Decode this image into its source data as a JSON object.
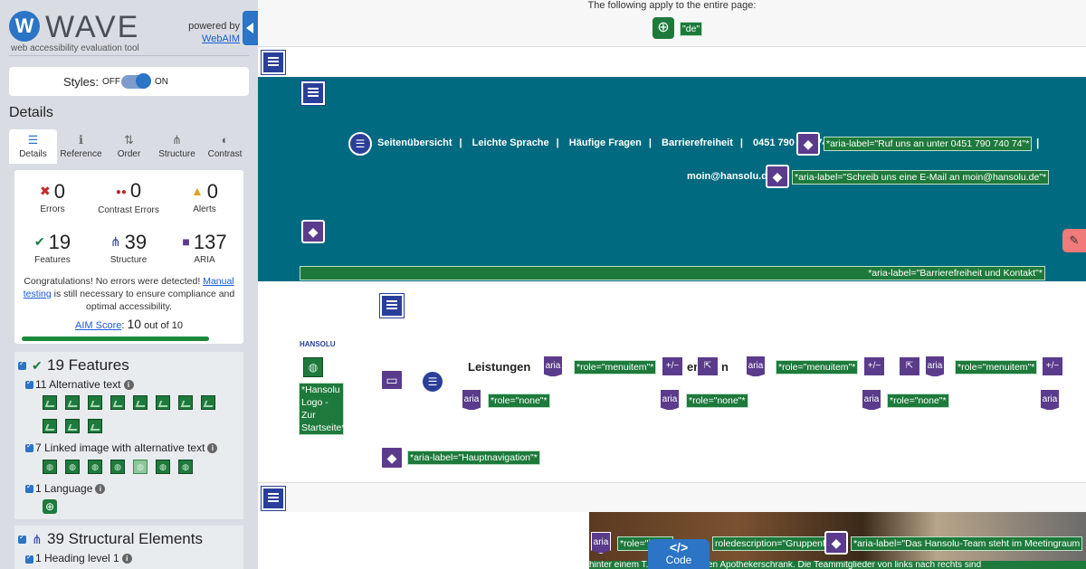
{
  "sidebar": {
    "brand": "WAVE",
    "brand_mark": "W",
    "brand_sub": "web accessibility evaluation tool",
    "powered_by": "powered by",
    "powered_link": "WebAIM",
    "styles_label": "Styles:",
    "styles_off": "OFF",
    "styles_on": "ON",
    "details_title": "Details",
    "tabs": [
      {
        "label": "Details",
        "icon": "list-icon",
        "glyph": "☰"
      },
      {
        "label": "Reference",
        "icon": "info-icon",
        "glyph": "ℹ"
      },
      {
        "label": "Order",
        "icon": "order-icon",
        "glyph": "⇅"
      },
      {
        "label": "Structure",
        "icon": "structure-icon",
        "glyph": "⋔"
      },
      {
        "label": "Contrast",
        "icon": "contrast-icon",
        "glyph": "◐"
      }
    ],
    "stats": [
      {
        "value": "0",
        "label": "Errors",
        "icon": "error-icon",
        "glyph": "✖",
        "color": "#c62828"
      },
      {
        "value": "0",
        "label": "Contrast Errors",
        "icon": "contrast-error-icon",
        "glyph": "●●",
        "color": "#c62828"
      },
      {
        "value": "0",
        "label": "Alerts",
        "icon": "alert-icon",
        "glyph": "▲",
        "color": "#e0a020"
      },
      {
        "value": "19",
        "label": "Features",
        "icon": "feature-icon",
        "glyph": "✔",
        "color": "#1e7a3c"
      },
      {
        "value": "39",
        "label": "Structure",
        "icon": "structure-icon",
        "glyph": "⋔",
        "color": "#2a3f9a"
      },
      {
        "value": "137",
        "label": "ARIA",
        "icon": "aria-icon",
        "glyph": "■",
        "color": "#5b3b8c"
      }
    ],
    "congrats_text": "Congratulations! No errors were detected!",
    "manual_link": "Manual testing",
    "congrats_rest": "is still necessary to ensure compliance and optimal accessibility.",
    "aim_label": "AIM Score",
    "aim_value": "10",
    "aim_suffix": "out of 10",
    "features_heading": "19 Features",
    "alt_text_row": "11 Alternative text",
    "linked_image_row": "7 Linked image with alternative text",
    "language_row": "1 Language",
    "structural_heading": "39 Structural Elements",
    "heading_row": "1 Heading level 1"
  },
  "page": {
    "top_note": "The following apply to the entire page:",
    "lang_tag": "\"de\"",
    "nav_links": [
      "Seitenübersicht",
      "Leichte Sprache",
      "Häufige Fragen",
      "Barrierefreiheit",
      "0451 790 740 74"
    ],
    "aria_phone": "*aria-label=\"Ruf uns an unter 0451 790 740 74\"*",
    "email": "moin@hansolu.de",
    "aria_email": "*aria-label=\"Schreib uns eine E-Mail an moin@hansolu.de\"*",
    "aria_contact": "*aria-label=\"Barrierefreiheit und Kontakt\"*",
    "logo_text": "HANSOLU",
    "logo_alt": "*Hansolu Logo - Zur Startseite*",
    "menu_label": "Leistungen",
    "role_menuitem": "*role=\"menuitem\"*",
    "role_none": "*role=\"none\"*",
    "aria_hauptnav": "*aria-label=\"Hauptnavigation\"*",
    "role_img": "*role=\"img\"*",
    "roledesc": "roledescription=\"Gruppenfoto\"*",
    "aria_team": "*aria-label=\"Das Hansolu-Team steht im Meetingraum",
    "photo_caption": "hinter einem T... vor einem alten Apothekerschrank. Die Teammitglieder von links nach rechts sind",
    "code_label": "Code",
    "code_glyph": "</>",
    "aria_text": "aria",
    "pm_text": "+/−",
    "partial_er": "er",
    "partial_n": "n"
  }
}
